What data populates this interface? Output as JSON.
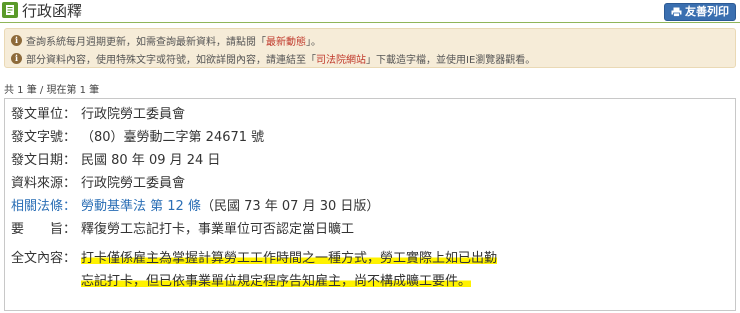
{
  "header": {
    "title": "行政函釋",
    "print_label": "友善列印"
  },
  "notice": {
    "line1_prefix": "查詢系統每月週期更新，如需查詢最新資料，請點閱「",
    "line1_link": "最新動態",
    "line1_suffix": "」。",
    "line2_prefix": "部分資料內容，使用特殊文字或符號，如欲詳閱內容，請連結至「",
    "line2_link": "司法院網站",
    "line2_suffix": "」下載造字檔，並使用IE瀏覽器觀看。"
  },
  "count_text": "共 1 筆 / 現在第 1 筆",
  "record": {
    "issuer_label": "發文單位：",
    "issuer_value": "行政院勞工委員會",
    "number_label": "發文字號：",
    "number_value": "（80）臺勞動二字第 24671 號",
    "date_label": "發文日期：",
    "date_value": "民國 80 年 09 月 24 日",
    "source_label": "資料來源：",
    "source_value": "行政院勞工委員會",
    "law_label": "相關法條：",
    "law_link": "勞動基準法 第 12 條",
    "law_suffix": "（民國 73 年 07 月 30 日版）",
    "gist_label": "要　　旨：",
    "gist_value": "釋復勞工忘記打卡，事業單位可否認定當日曠工",
    "full_label": "全文內容：",
    "full_line1": "打卡僅係雇主為掌握計算勞工工作時間之一種方式，勞工實際上如已出勤",
    "full_line2": "忘記打卡，但已依事業單位規定程序告知雇主，尚不構成曠工要件。"
  }
}
